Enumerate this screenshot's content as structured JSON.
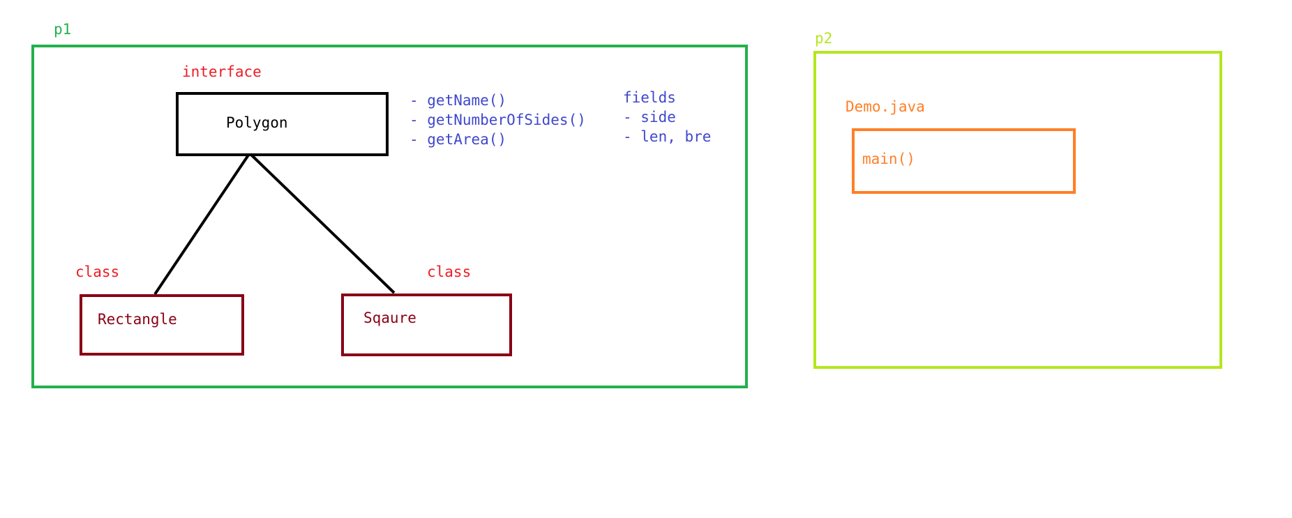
{
  "packages": {
    "p1": {
      "label": "p1",
      "color": "#22b14c"
    },
    "p2": {
      "label": "p2",
      "color": "#b5e61d"
    }
  },
  "polygon": {
    "stereotype": "interface",
    "name": "Polygon",
    "methods": [
      "- getName()",
      "- getNumberOfSides()",
      "- getArea()"
    ],
    "fields_header": "fields",
    "fields": [
      "- side",
      "- len, bre"
    ]
  },
  "rectangle": {
    "stereotype": "class",
    "name": "Rectangle"
  },
  "square": {
    "stereotype": "class",
    "name": "Sqaure"
  },
  "demo": {
    "filename": "Demo.java",
    "method": "main()"
  },
  "colors": {
    "interface_label": "#ed1c24",
    "class_box": "#880015",
    "members": "#3f48cc",
    "demo": "#ff7f27",
    "connector": "#000000"
  }
}
